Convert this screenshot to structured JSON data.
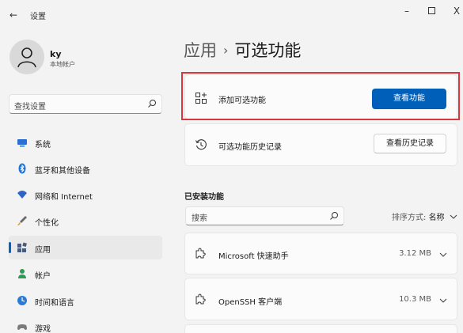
{
  "titlebar": {
    "back": "←",
    "title": "设置",
    "minimize": "–",
    "maximize": "☐",
    "close": "X"
  },
  "user": {
    "name": "ky",
    "account_type": "本地帐户"
  },
  "sidebar": {
    "search_placeholder": "查找设置",
    "items": [
      {
        "label": "系统",
        "icon": "system-icon",
        "selected": false
      },
      {
        "label": "蓝牙和其他设备",
        "icon": "bluetooth-icon",
        "selected": false
      },
      {
        "label": "网络和 Internet",
        "icon": "wifi-icon",
        "selected": false
      },
      {
        "label": "个性化",
        "icon": "brush-icon",
        "selected": false
      },
      {
        "label": "应用",
        "icon": "apps-icon",
        "selected": true
      },
      {
        "label": "帐户",
        "icon": "account-icon",
        "selected": false
      },
      {
        "label": "时间和语言",
        "icon": "globe-clock-icon",
        "selected": false
      },
      {
        "label": "游戏",
        "icon": "gamepad-icon",
        "selected": false
      }
    ]
  },
  "breadcrumb": {
    "parent": "应用",
    "separator": "›",
    "current": "可选功能"
  },
  "add_feature": {
    "label": "添加可选功能",
    "button": "查看功能"
  },
  "history": {
    "label": "可选功能历史记录",
    "button": "查看历史记录"
  },
  "installed": {
    "title": "已安装功能",
    "search_placeholder": "搜索",
    "sort_label": "排序方式:",
    "sort_value": "名称",
    "features": [
      {
        "name": "Microsoft 快速助手",
        "size": "3.12 MB"
      },
      {
        "name": "OpenSSH 客户端",
        "size": "10.3 MB"
      }
    ]
  },
  "colors": {
    "accent": "#005fb8",
    "highlight": "#d9363e"
  }
}
